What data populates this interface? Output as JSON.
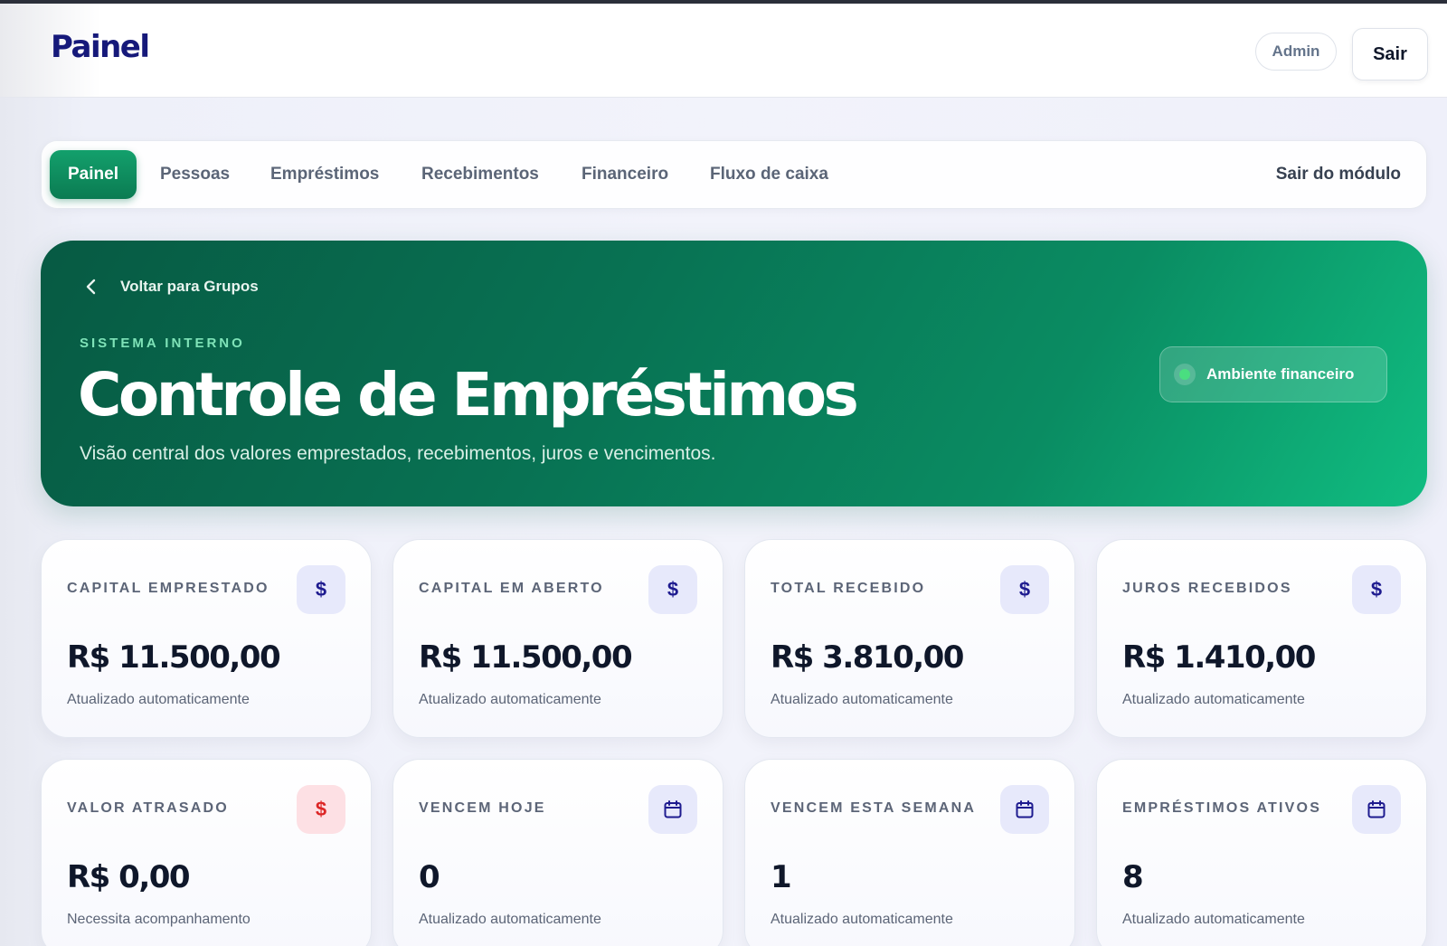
{
  "header": {
    "brand": "Painel",
    "user_badge": "Admin",
    "logout_label": "Sair"
  },
  "nav": {
    "tabs": [
      {
        "label": "Painel",
        "active": true
      },
      {
        "label": "Pessoas",
        "active": false
      },
      {
        "label": "Empréstimos",
        "active": false
      },
      {
        "label": "Recebimentos",
        "active": false
      },
      {
        "label": "Financeiro",
        "active": false
      },
      {
        "label": "Fluxo de caixa",
        "active": false
      }
    ],
    "exit_module_label": "Sair do módulo"
  },
  "hero": {
    "back_label": "Voltar para Grupos",
    "eyebrow": "SISTEMA INTERNO",
    "title": "Controle de Empréstimos",
    "subtitle": "Visão central dos valores emprestados, recebimentos, juros e vencimentos.",
    "environment_badge": "Ambiente financeiro"
  },
  "cards": [
    {
      "label": "CAPITAL EMPRESTADO",
      "value": "R$ 11.500,00",
      "note": "Atualizado automaticamente",
      "icon": "dollar-icon"
    },
    {
      "label": "CAPITAL EM ABERTO",
      "value": "R$ 11.500,00",
      "note": "Atualizado automaticamente",
      "icon": "dollar-icon"
    },
    {
      "label": "TOTAL RECEBIDO",
      "value": "R$ 3.810,00",
      "note": "Atualizado automaticamente",
      "icon": "dollar-icon"
    },
    {
      "label": "JUROS RECEBIDOS",
      "value": "R$ 1.410,00",
      "note": "Atualizado automaticamente",
      "icon": "dollar-icon"
    },
    {
      "label": "VALOR ATRASADO",
      "value": "R$ 0,00",
      "note": "Necessita acompanhamento",
      "icon": "dollar-alert-icon"
    },
    {
      "label": "VENCEM HOJE",
      "value": "0",
      "note": "Atualizado automaticamente",
      "icon": "calendar-icon"
    },
    {
      "label": "VENCEM ESTA SEMANA",
      "value": "1",
      "note": "Atualizado automaticamente",
      "icon": "calendar-icon"
    },
    {
      "label": "EMPRÉSTIMOS ATIVOS",
      "value": "8",
      "note": "Atualizado automaticamente",
      "icon": "calendar-icon"
    }
  ],
  "colors": {
    "brand": "#16197a",
    "accent_green": "#0b7b52",
    "hero_start": "#075a43",
    "hero_end": "#10bd81",
    "danger": "#dc2626"
  }
}
